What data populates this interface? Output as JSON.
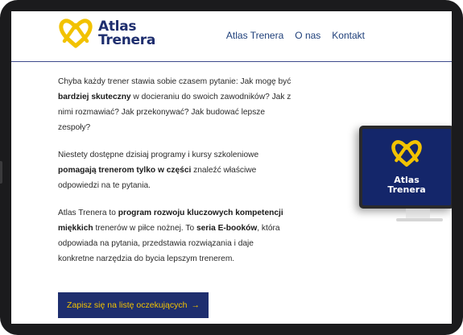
{
  "header": {
    "logo": {
      "line1": "Atlas",
      "line2": "Trenera"
    },
    "nav": [
      {
        "label": "Atlas Trenera"
      },
      {
        "label": "O nas"
      },
      {
        "label": "Kontakt"
      }
    ]
  },
  "content": {
    "p1": {
      "t1": "Chyba każdy trener stawia sobie czasem pytanie: Jak mogę być ",
      "b1": "bardziej skuteczny",
      "t2": " w docieraniu do swoich zawodników? Jak z nimi rozmawiać? Jak przekonywać? Jak budować lepsze zespoły?"
    },
    "p2": {
      "t1": "Niestety dostępne dzisiaj programy i kursy szkoleniowe ",
      "b1": "pomagają trenerom tylko w części",
      "t2": " znaleźć właściwe odpowiedzi na te pytania."
    },
    "p3": {
      "t1": "Atlas Trenera to ",
      "b1": "program rozwoju kluczowych kompetencji miękkich",
      "t2": " trenerów w piłce nożnej. To ",
      "b2": "seria E-booków",
      "t3": ", która odpowiada na pytania, przedstawia rozwiązania i daje konkretne narzędzia do bycia lepszym trenerem."
    }
  },
  "cta": {
    "label": "Zapisz się na listę oczekujących",
    "arrow": "→"
  },
  "monitor": {
    "line1": "Atlas",
    "line2": "Trenera"
  },
  "colors": {
    "brand_navy": "#1e2e6e",
    "brand_yellow": "#f2c200",
    "nav_text": "#1e3f7a"
  },
  "icons": [
    "heart-logo-icon",
    "arrow-right-icon"
  ]
}
